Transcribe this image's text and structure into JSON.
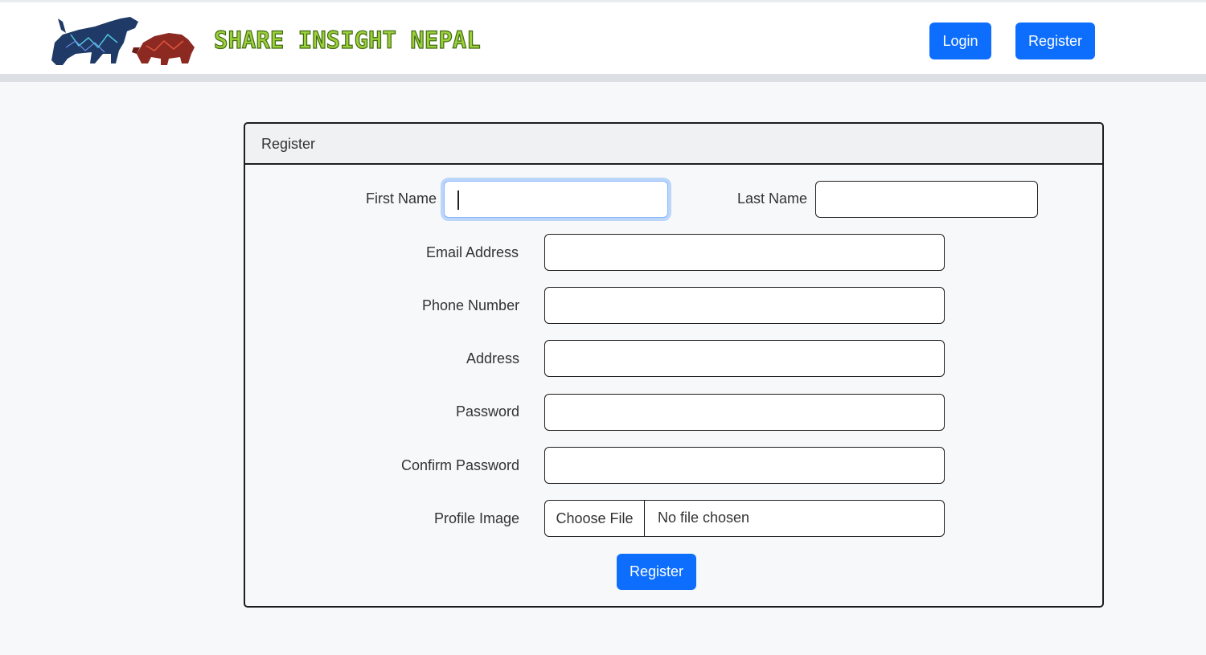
{
  "header": {
    "brand_text": "SHARE INSIGHT NEPAL",
    "logo_icon": "bull-bear-logo-icon",
    "login_label": "Login",
    "register_label": "Register"
  },
  "form": {
    "title": "Register",
    "fields": {
      "first_name": {
        "label": "First Name",
        "value": ""
      },
      "last_name": {
        "label": "Last Name",
        "value": ""
      },
      "email": {
        "label": "Email Address",
        "value": ""
      },
      "phone": {
        "label": "Phone Number",
        "value": ""
      },
      "address": {
        "label": "Address",
        "value": ""
      },
      "password": {
        "label": "Password",
        "value": ""
      },
      "confirm_password": {
        "label": "Confirm Password",
        "value": ""
      },
      "profile_image": {
        "label": "Profile Image",
        "button": "Choose File",
        "status": "No file chosen"
      }
    },
    "submit_label": "Register"
  },
  "colors": {
    "primary": "#0d6efd",
    "page_background": "#f7f8fa",
    "brand_green": "#9ccf3a"
  }
}
